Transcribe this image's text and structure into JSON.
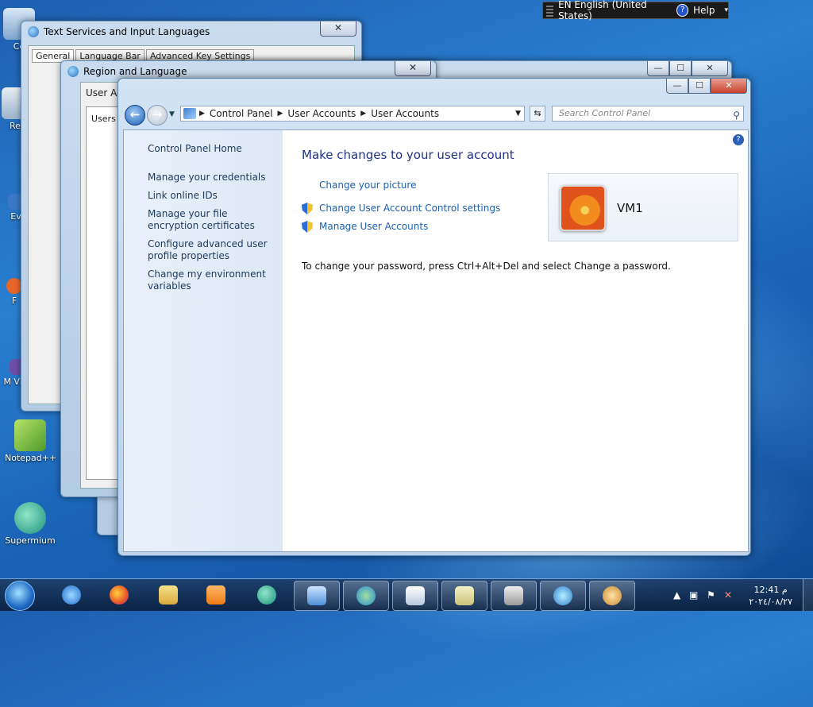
{
  "language_bar": {
    "language": "EN English (United States)",
    "help": "Help"
  },
  "desktop_icons": [
    {
      "label": "Co",
      "name": "computer"
    },
    {
      "label": "Rec",
      "name": "recycle-bin"
    },
    {
      "label": "Ev",
      "name": "event"
    },
    {
      "label": "F",
      "name": "firefox"
    },
    {
      "label": "M Visc",
      "name": "visual-studio"
    },
    {
      "label": "Notepad++",
      "name": "notepad-plus-plus"
    },
    {
      "label": "Supermium",
      "name": "supermium"
    }
  ],
  "bg_windows": {
    "text_services": {
      "title": "Text Services and Input Languages",
      "tabs": [
        "General",
        "Language Bar",
        "Advanced Key Settings"
      ],
      "close": "✕"
    },
    "region": {
      "title": "Region and Language",
      "close": "✕"
    },
    "user_accounts_dialog": {
      "title": "User Ac",
      "tab": "Users"
    },
    "third": {
      "min": "—",
      "max": "☐",
      "close": "✕"
    }
  },
  "main_window": {
    "caption": {
      "min": "—",
      "max": "☐",
      "close": "✕"
    },
    "breadcrumb": [
      "Control Panel",
      "User Accounts",
      "User Accounts"
    ],
    "search_placeholder": "Search Control Panel",
    "left_links": [
      "Control Panel Home",
      "Manage your credentials",
      "Link online IDs",
      "Manage your file encryption certificates",
      "Configure advanced user profile properties",
      "Change my environment variables"
    ],
    "heading": "Make changes to your user account",
    "tasks": [
      {
        "label": "Change your picture",
        "shield": false
      },
      {
        "label": "Change User Account Control settings",
        "shield": true
      },
      {
        "label": "Manage User Accounts",
        "shield": true
      }
    ],
    "user_name": "VM1",
    "password_note": "To change your password, press Ctrl+Alt+Del and select Change a password."
  },
  "taskbar": {
    "buttons": [
      "internet-explorer",
      "firefox",
      "file-explorer",
      "media-player",
      "supermium",
      "control-panel",
      "network",
      "calendar",
      "keyboard",
      "disk",
      "globe",
      "users"
    ],
    "clock_time": "12:41 م",
    "clock_date": "٢٠٢٤/٠٨/٢٧"
  },
  "colors": {
    "accent": "#1c5fb0",
    "heading": "#1e3287",
    "close_red": "#c7402c"
  }
}
